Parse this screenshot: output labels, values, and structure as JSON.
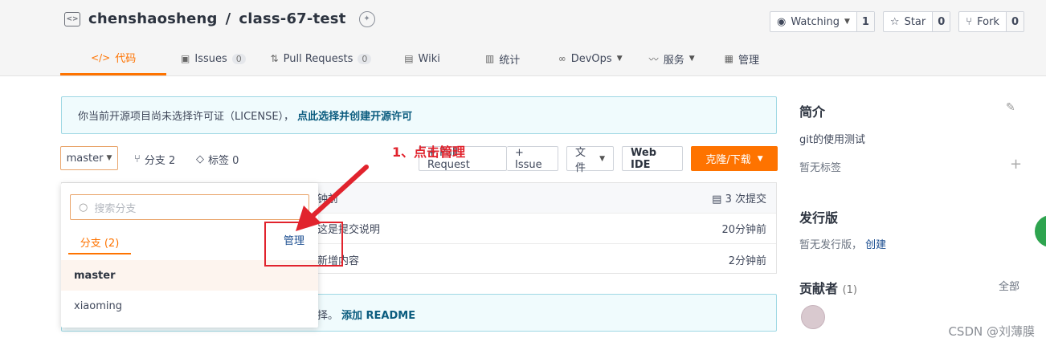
{
  "repo": {
    "owner": "chenshaosheng",
    "separator": "/",
    "name": "class-67-test"
  },
  "actions": {
    "watching": {
      "label": "Watching",
      "count": "1"
    },
    "star": {
      "label": "Star",
      "count": "0"
    },
    "fork": {
      "label": "Fork",
      "count": "0"
    }
  },
  "tabs": [
    {
      "label": "代码",
      "icon": "code-icon"
    },
    {
      "label": "Issues",
      "count": "0",
      "icon": "issues-icon"
    },
    {
      "label": "Pull Requests",
      "count": "0",
      "icon": "pull-request-icon"
    },
    {
      "label": "Wiki",
      "icon": "wiki-icon"
    },
    {
      "label": "统计",
      "icon": "chart-icon"
    },
    {
      "label": "DevOps",
      "icon": "devops-icon"
    },
    {
      "label": "服务",
      "icon": "service-icon"
    },
    {
      "label": "管理",
      "icon": "manage-icon"
    }
  ],
  "license_notice": {
    "text": "你当前开源项目尚未选择许可证（LICENSE），",
    "link": "点此选择并创建开源许可"
  },
  "branch_row": {
    "branch": "master",
    "branches": "分支 2",
    "tags": "标签 0"
  },
  "toolbar": {
    "pull_request": "+ Pull Request",
    "issue": "+ Issue",
    "files": "文件",
    "web_ide": "Web IDE",
    "clone": "克隆/下载"
  },
  "commits": {
    "header_left": "钟前",
    "header_right": "3 次提交",
    "rows": [
      {
        "message": "这是提交说明",
        "time": "20分钟前"
      },
      {
        "message": "新增内容",
        "time": "2分钟前"
      }
    ]
  },
  "readme_notice": {
    "text": "择。",
    "link": "添加 README"
  },
  "dropdown": {
    "search_placeholder": "搜索分支",
    "tab_label": "分支 (2)",
    "manage_label": "管理",
    "branches": [
      "master",
      "xiaoming"
    ]
  },
  "annotation": "1、点击管理",
  "sidebar": {
    "intro_title": "简介",
    "intro_text": "git的使用测试",
    "no_tags": "暂无标签",
    "release_title": "发行版",
    "no_release": "暂无发行版，",
    "create": "创建",
    "contributors_title": "贡献者",
    "contributors_count": "(1)",
    "all": "全部"
  },
  "watermark": "CSDN @刘薄膜"
}
